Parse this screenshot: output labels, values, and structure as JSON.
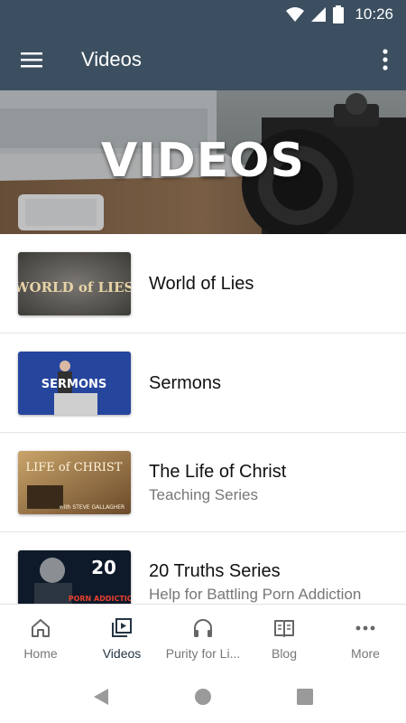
{
  "status_bar": {
    "time": "10:26"
  },
  "app_bar": {
    "title": "Videos"
  },
  "hero": {
    "title": "VIDEOS"
  },
  "list": {
    "items": [
      {
        "title": "World of Lies",
        "subtitle": "",
        "thumb_text": "WORLD of LIES"
      },
      {
        "title": "Sermons",
        "subtitle": "",
        "thumb_text": "SERMONS"
      },
      {
        "title": "The Life of Christ",
        "subtitle": "Teaching Series",
        "thumb_text": "LIFE of CHRIST",
        "thumb_subtext": "with STEVE GALLAGHER"
      },
      {
        "title": "20 Truths Series",
        "subtitle": "Help for Battling Porn Addiction",
        "thumb_text": "20",
        "thumb_subtext": "PORN ADDICTION"
      }
    ]
  },
  "bottom_nav": {
    "items": [
      {
        "label": "Home",
        "icon": "home-icon"
      },
      {
        "label": "Videos",
        "icon": "video-library-icon"
      },
      {
        "label": "Purity for Li...",
        "icon": "headphones-icon"
      },
      {
        "label": "Blog",
        "icon": "book-icon"
      },
      {
        "label": "More",
        "icon": "more-horizontal-icon"
      }
    ],
    "active_index": 1
  },
  "colors": {
    "app_bar": "#3c4f60",
    "active_nav": "#243443",
    "inactive_nav": "#777777"
  }
}
